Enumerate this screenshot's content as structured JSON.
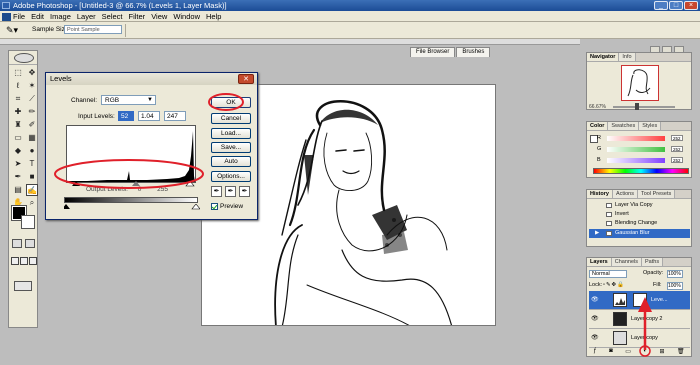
{
  "app": {
    "title": "Adobe Photoshop - [Untitled-3 @ 66.7% (Levels 1, Layer Mask)]",
    "menu": [
      "File",
      "Edit",
      "Image",
      "Layer",
      "Select",
      "Filter",
      "View",
      "Window",
      "Help"
    ]
  },
  "options_bar": {
    "tool_icon": "eyedropper-icon",
    "sample_size_label": "Sample Size:",
    "sample_size_value": "Point Sample"
  },
  "palette_well": {
    "tabs": [
      "File Browser",
      "Brushes"
    ]
  },
  "levels_dialog": {
    "title": "Levels",
    "channel_label": "Channel:",
    "channel_value": "RGB",
    "input_label": "Input Levels:",
    "input_values": [
      "52",
      "1.04",
      "247"
    ],
    "output_label": "Output Levels:",
    "output_values": [
      "0",
      "255"
    ],
    "buttons": {
      "ok": "OK",
      "cancel": "Cancel",
      "load": "Load...",
      "save": "Save...",
      "auto": "Auto",
      "options": "Options..."
    },
    "preview_label": "Preview",
    "preview_checked": true
  },
  "navigator": {
    "tabs": [
      "Navigator",
      "Info"
    ],
    "zoom": "66.67%"
  },
  "color_panel": {
    "tabs": [
      "Color",
      "Swatches",
      "Styles"
    ],
    "channels": [
      {
        "letter": "R",
        "value": "252",
        "gradient_end": "#ff4040"
      },
      {
        "letter": "G",
        "value": "252",
        "gradient_end": "#40c040"
      },
      {
        "letter": "B",
        "value": "252",
        "gradient_end": "#8040ff"
      }
    ]
  },
  "history": {
    "tabs": [
      "History",
      "Actions",
      "Tool Presets"
    ],
    "items": [
      "Layer Via Copy",
      "Invert",
      "Blending Change",
      "Gaussian Blur"
    ],
    "selected_index": 3
  },
  "layers": {
    "tabs": [
      "Layers",
      "Channels",
      "Paths"
    ],
    "blend_mode": "Normal",
    "opacity_label": "Opacity:",
    "opacity_value": "100%",
    "lock_label": "Lock:",
    "fill_label": "Fill:",
    "fill_value": "100%",
    "items": [
      {
        "name": "Leve...",
        "selected": true
      },
      {
        "name": "Layer copy 2",
        "selected": false
      },
      {
        "name": "Layer copy",
        "selected": false
      }
    ]
  },
  "annotation_color": "#e0202a"
}
